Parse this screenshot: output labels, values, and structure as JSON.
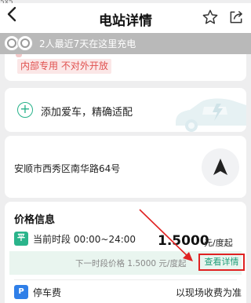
{
  "header": {
    "title": "电站详情",
    "back_icon": "chevron-left-icon",
    "star_icon": "star-outline-icon",
    "share_icon": "share-icon"
  },
  "notice": {
    "text": "2人最近7天在这里充电",
    "background": "#b9b9b9"
  },
  "internal_tag": "内部专用 不对外开放",
  "add_car": {
    "label": "添加爱车，精确适配"
  },
  "location": {
    "address": "安顺市西秀区南华路64号"
  },
  "price": {
    "title": "价格信息",
    "period_tag": "平",
    "period": "当前时段 00:00~24:00",
    "amount": "1.5000",
    "unit": "元/度起",
    "next_period": "下一时段价格 1.5000 元/度起",
    "detail_link": "查看详情"
  },
  "parking": {
    "tag": "P",
    "label": "停车费",
    "value": "以现场收费为准"
  },
  "colors": {
    "accent": "#27b28a",
    "annotation": "#e02222",
    "parking_tag": "#2f7fe8"
  }
}
